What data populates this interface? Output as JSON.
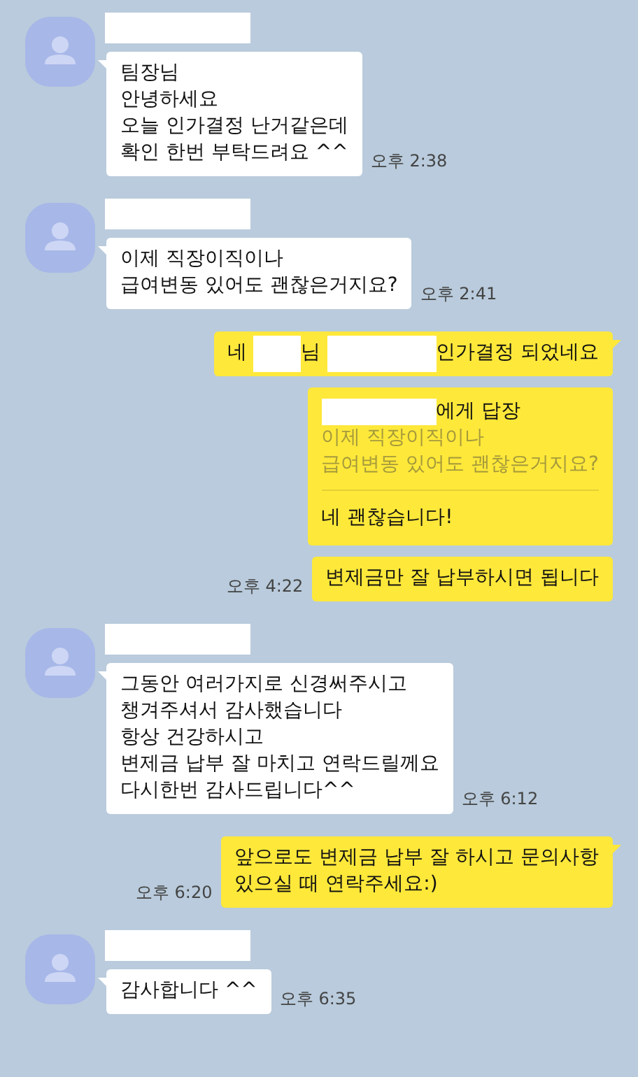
{
  "messages": [
    {
      "outgoing": false,
      "sender_hidden": true,
      "tail": true,
      "kind": "text",
      "lines": [
        "팀장님",
        "안녕하세요",
        "오늘 인가결정 난거같은데",
        "확인 한번 부탁드려요 ^^"
      ],
      "time": "오후 2:38"
    },
    {
      "outgoing": false,
      "sender_hidden": true,
      "tail": true,
      "kind": "text",
      "lines": [
        "이제 직장이직이나",
        "급여변동 있어도 괜찮은거지요?"
      ],
      "time": "오후 2:41"
    },
    {
      "outgoing": true,
      "tail": true,
      "kind": "segments",
      "segments": [
        {
          "kind": "text",
          "text": "네 "
        },
        {
          "kind": "hidden",
          "wide": false
        },
        {
          "kind": "text",
          "text": "님 "
        },
        {
          "kind": "hidden",
          "wide": true
        },
        {
          "kind": "text",
          "text": "인가결정 되었네요"
        }
      ]
    },
    {
      "outgoing": true,
      "tail": false,
      "kind": "reply",
      "reply_header": "에게 답장",
      "quote_lines": [
        "이제 직장이직이나",
        "급여변동 있어도 괜찮은거지요?"
      ],
      "lines": [
        "네 괜찮습니다!"
      ]
    },
    {
      "outgoing": true,
      "tail": false,
      "kind": "text",
      "lines": [
        "변제금만 잘 납부하시면 됩니다"
      ],
      "time": "오후 4:22"
    },
    {
      "outgoing": false,
      "sender_hidden": true,
      "tail": true,
      "kind": "text",
      "lines": [
        "그동안 여러가지로 신경써주시고",
        "챙겨주셔서 감사했습니다",
        "항상 건강하시고",
        "변제금 납부 잘 마치고 연락드릴께요",
        "다시한번 감사드립니다^^"
      ],
      "time": "오후 6:12"
    },
    {
      "outgoing": true,
      "tail": true,
      "kind": "text",
      "lines": [
        "앞으로도 변제금 납부 잘 하시고 문의사항",
        "있으실 때 연락주세요:)"
      ],
      "time": "오후 6:20"
    },
    {
      "outgoing": false,
      "sender_hidden": true,
      "tail": true,
      "kind": "text",
      "lines": [
        "감사합니다 ^^"
      ],
      "time": "오후 6:35"
    }
  ]
}
